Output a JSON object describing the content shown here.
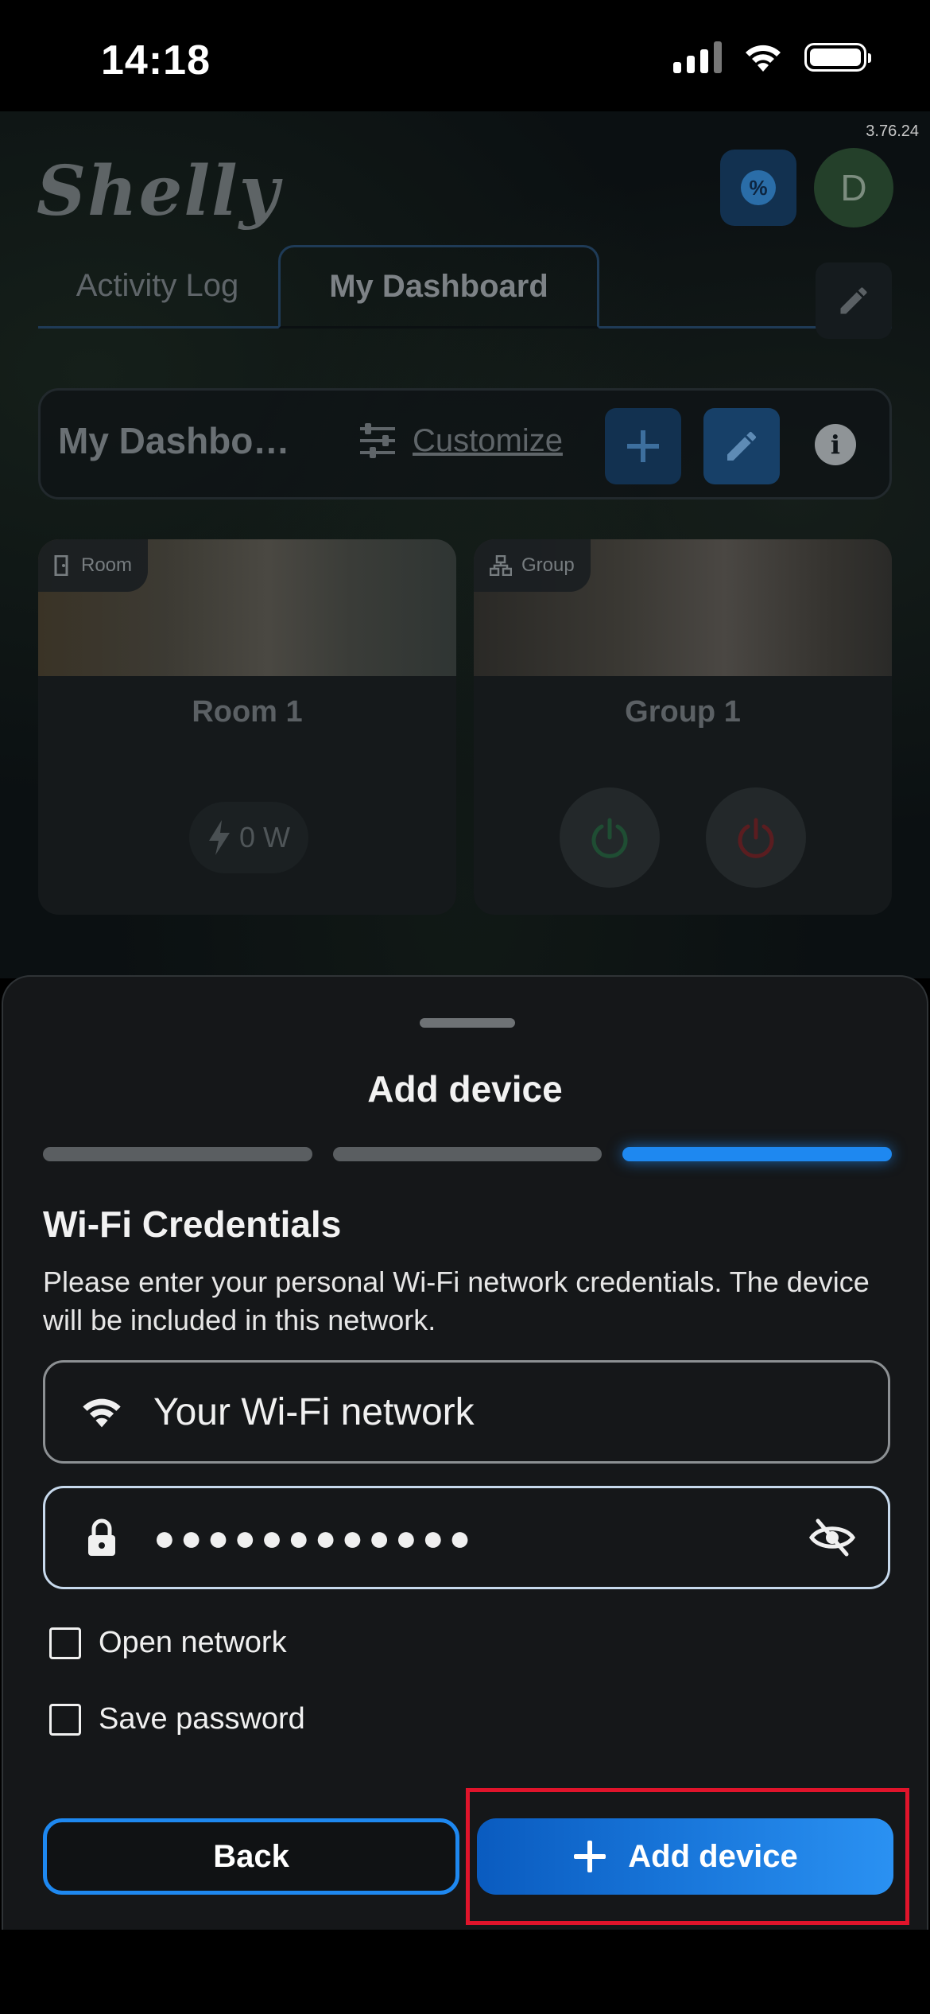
{
  "status_bar": {
    "time": "14:18"
  },
  "app": {
    "version": "3.76.24",
    "logo_text": "Shelly",
    "avatar_initial": "D",
    "tabs": [
      {
        "label": "Activity Log"
      },
      {
        "label": "My Dashboard"
      }
    ],
    "dashboard_bar": {
      "name": "My Dashbo…",
      "customize_label": "Customize"
    },
    "cards": [
      {
        "tag": "Room",
        "title": "Room 1",
        "power": "0 W"
      },
      {
        "tag": "Group",
        "title": "Group 1"
      }
    ]
  },
  "sheet": {
    "title": "Add device",
    "steps": [
      {
        "active": false
      },
      {
        "active": false
      },
      {
        "active": true
      }
    ],
    "section_title": "Wi-Fi Credentials",
    "description": "Please enter your personal Wi-Fi network credentials. The device will be included in this network.",
    "ssid_value": "Your Wi-Fi network",
    "password_value": "●●●●●●●●●●●●",
    "open_network_label": "Open network",
    "save_password_label": "Save password",
    "back_label": "Back",
    "add_label": "Add device"
  },
  "colors": {
    "accent": "#1e88f0",
    "highlight": "#e0142b",
    "sheet_bg": "#151719"
  }
}
